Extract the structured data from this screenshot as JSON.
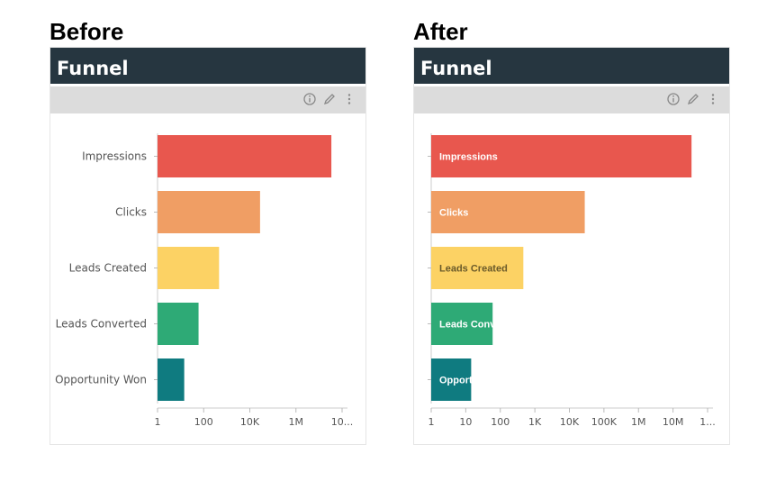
{
  "before_label": "Before",
  "after_label": "After",
  "panel_title": "Funnel",
  "toolbar_icons": [
    "info-icon",
    "pencil-icon",
    "more-vertical-icon"
  ],
  "colors": {
    "title_bar": "#263640",
    "toolbar": "#dcdcdc",
    "bars": [
      "#e8574e",
      "#f09e64",
      "#fcd264",
      "#2eaa76",
      "#0f7b80"
    ]
  },
  "chart_data": [
    {
      "type": "bar",
      "orientation": "horizontal",
      "x_scale": "log",
      "label_position": "outside-left",
      "categories": [
        "Impressions",
        "Clicks",
        "Leads Created",
        "Leads Converted",
        "Opportunity Won"
      ],
      "values": [
        300000000,
        100000,
        1000,
        100,
        20
      ],
      "xlim": [
        1,
        1000000000
      ],
      "x_ticks": [
        "1",
        "100",
        "10K",
        "1M",
        "10..."
      ],
      "grid": false
    },
    {
      "type": "bar",
      "orientation": "horizontal",
      "x_scale": "log",
      "label_position": "inside",
      "categories": [
        "Impressions",
        "Clicks",
        "Leads Created",
        "Leads Converted",
        "Opportunity Won"
      ],
      "values": [
        300000000,
        100000,
        1000,
        100,
        20
      ],
      "xlim": [
        1,
        1000000000
      ],
      "x_ticks": [
        "1",
        "10",
        "100",
        "1K",
        "10K",
        "100K",
        "1M",
        "10M",
        "1..."
      ],
      "grid": false
    }
  ]
}
